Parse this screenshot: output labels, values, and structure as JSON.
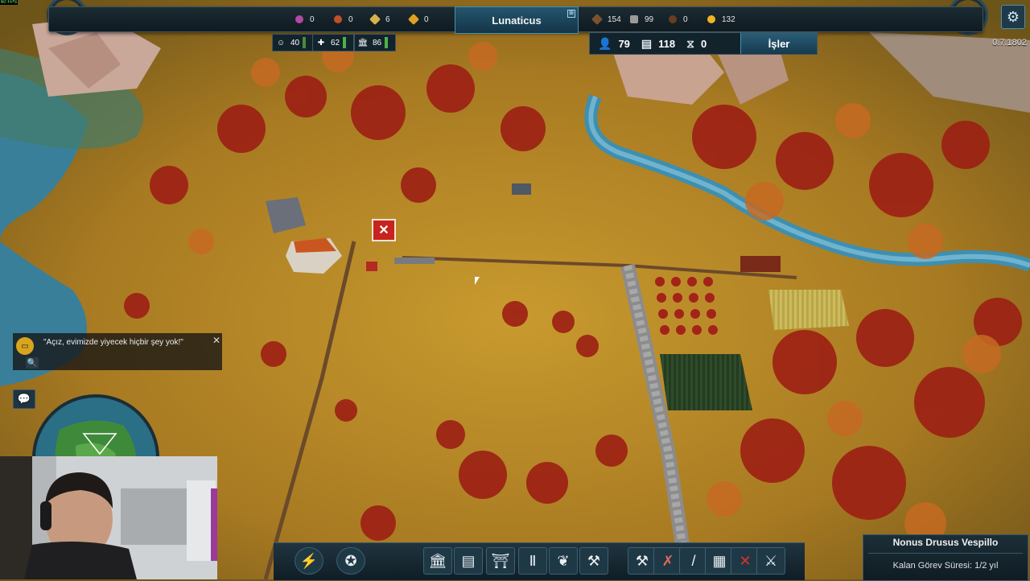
{
  "hud": {
    "fps": "60 FPS",
    "version": "0.7.1802",
    "city_name": "Lunaticus",
    "resources_left": [
      {
        "icon": "grapes-icon",
        "value": "0",
        "color": "#b04aa0"
      },
      {
        "icon": "meat-icon",
        "value": "0",
        "color": "#c0502a"
      },
      {
        "icon": "tool-icon",
        "value": "6",
        "color": "#d6b24a"
      },
      {
        "icon": "ingot-icon",
        "value": "0",
        "color": "#e0a020"
      }
    ],
    "resources_right": [
      {
        "icon": "wood-icon",
        "value": "154",
        "color": "#7a5230"
      },
      {
        "icon": "stone-icon",
        "value": "99",
        "color": "#9a9a9a"
      },
      {
        "icon": "leather-icon",
        "value": "0",
        "color": "#6b3d1e"
      },
      {
        "icon": "coin-icon",
        "value": "132",
        "color": "#f0b323"
      }
    ],
    "stats": [
      {
        "icon": "happiness-icon",
        "value": "40",
        "meter_color": "#4a8a3a"
      },
      {
        "icon": "health-icon",
        "value": "62",
        "meter_color": "#4fb04a"
      },
      {
        "icon": "culture-icon",
        "value": "86",
        "meter_color": "#4fb04a"
      }
    ],
    "population": [
      {
        "icon": "citizen-icon",
        "value": "79"
      },
      {
        "icon": "housing-icon",
        "value": "118"
      },
      {
        "icon": "unemployed-icon",
        "value": "0"
      }
    ],
    "jobs_button": "İşler"
  },
  "notification": {
    "message": "\"Açız, evimizde yiyecek hiçbir şey yok!\""
  },
  "toolbar": {
    "buttons": [
      {
        "name": "quick-build-button",
        "glyph": "⚡",
        "round": true
      },
      {
        "name": "favor-button",
        "glyph": "✪",
        "round": true
      },
      {
        "name": "government-button",
        "glyph": "🏛",
        "round": false
      },
      {
        "name": "housing-button",
        "glyph": "▤",
        "round": false
      },
      {
        "name": "temple-button",
        "glyph": "⛩",
        "round": false
      },
      {
        "name": "monument-button",
        "glyph": "Ⅱ",
        "round": false
      },
      {
        "name": "farming-button",
        "glyph": "❦",
        "round": false
      },
      {
        "name": "industry-button",
        "glyph": "⚒",
        "round": false
      },
      {
        "name": "tools-button",
        "glyph": "⚒",
        "round": false
      },
      {
        "name": "demolish-road-button",
        "glyph": "✗",
        "round": false
      },
      {
        "name": "road-button",
        "glyph": "/",
        "round": false
      },
      {
        "name": "storage-button",
        "glyph": "▦",
        "round": false
      },
      {
        "name": "cancel-button",
        "glyph": "✕",
        "round": false
      },
      {
        "name": "sword-button",
        "glyph": "⚔",
        "round": false
      }
    ]
  },
  "quest": {
    "governor": "Nonus Drusus Vespillo",
    "remaining": "Kalan Görev Süresi: 1/2 yıl"
  }
}
